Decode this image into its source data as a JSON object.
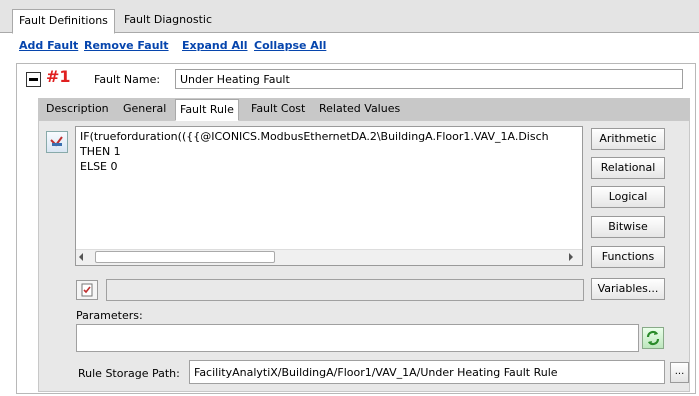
{
  "top_tabs": [
    {
      "label": "Fault Definitions",
      "active": true
    },
    {
      "label": "Fault Diagnostic",
      "active": false
    }
  ],
  "actions": {
    "add_fault": "Add Fault",
    "remove_fault": "Remove Fault",
    "expand_all": "Expand All",
    "collapse_all": "Collapse All"
  },
  "fault": {
    "number": "#1",
    "name_label": "Fault Name:",
    "name_value": "Under Heating Fault"
  },
  "inner_tabs": [
    {
      "label": "Description",
      "active": false
    },
    {
      "label": "General",
      "active": false
    },
    {
      "label": "Fault Rule",
      "active": true
    },
    {
      "label": "Fault Cost",
      "active": false
    },
    {
      "label": "Related Values",
      "active": false
    }
  ],
  "rule": {
    "lines": [
      "IF(trueforduration(({{@ICONICS.ModbusEthernetDA.2\\BuildingA.Floor1.VAV_1A.Disch",
      "THEN 1",
      "ELSE 0"
    ]
  },
  "side_buttons": [
    "Arithmetic",
    "Relational",
    "Logical",
    "Bitwise",
    "Functions",
    "Variables..."
  ],
  "parameters_label": "Parameters:",
  "storage": {
    "label": "Rule Storage Path:",
    "value": "FacilityAnalytiX/BuildingA/Floor1/VAV_1A/Under Heating Fault Rule",
    "browse_label": "..."
  },
  "colors": {
    "link": "#0645ad",
    "fault_number": "#e02020",
    "tab_strip": "#c8c8c8"
  }
}
